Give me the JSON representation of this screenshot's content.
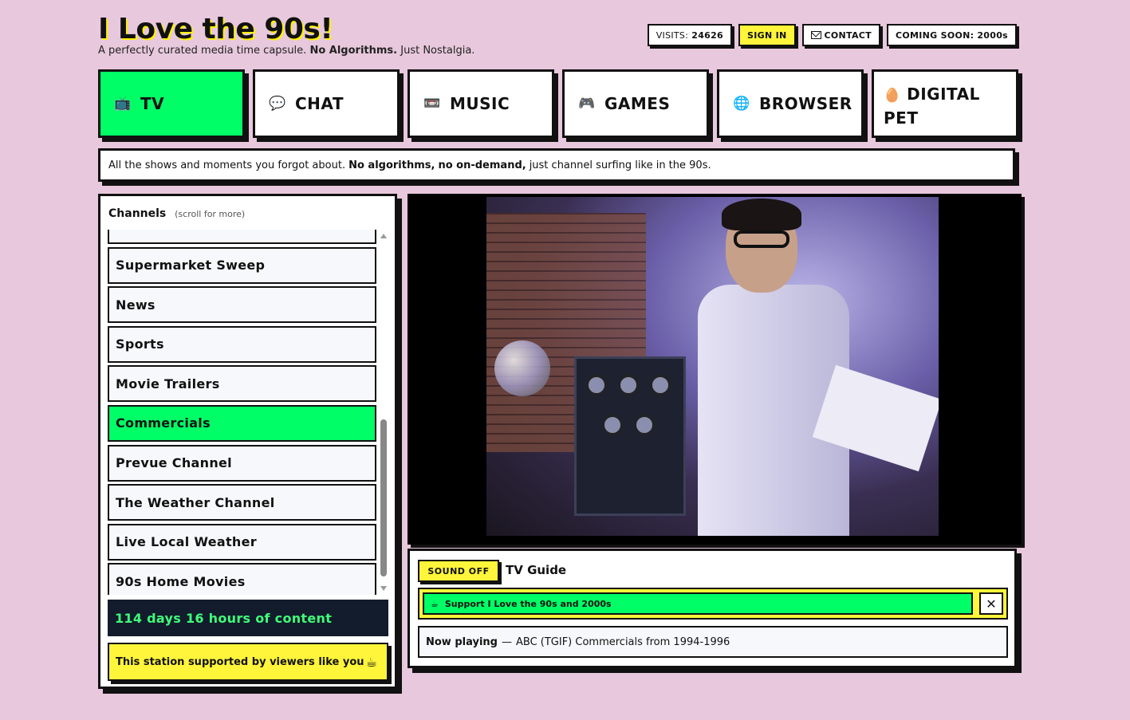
{
  "header": {
    "title": "I Love the 90s!",
    "tagline_pre": "A perfectly curated media time capsule.",
    "tagline_bold": "No Algorithms.",
    "tagline_post": "Just Nostalgia."
  },
  "top_actions": {
    "visits_label": "VISITS:",
    "visits_count": "24626",
    "sign_in": "SIGN IN",
    "contact": "CONTACT",
    "coming_soon_label": "COMING SOON:",
    "coming_soon_value": "2000s"
  },
  "tabs": [
    {
      "label": "TV",
      "icon": "📺"
    },
    {
      "label": "CHAT",
      "icon": "💬"
    },
    {
      "label": "MUSIC",
      "icon": "📼"
    },
    {
      "label": "GAMES",
      "icon": "🎮"
    },
    {
      "label": "BROWSER",
      "icon": "🌐"
    },
    {
      "label": "DIGITAL PET",
      "icon": "🥚"
    }
  ],
  "infobar": {
    "pre": "All the shows and moments you forgot about.",
    "bold1": "No algorithms,",
    "bold2": "no on-demand,",
    "post": "just channel surfing like in the 90s."
  },
  "channels": {
    "heading": "Channels",
    "hint": "(scroll for more)",
    "items": [
      "Supermarket Sweep",
      "News",
      "Sports",
      "Movie Trailers",
      "Commercials",
      "Prevue Channel",
      "The Weather Channel",
      "Live Local Weather",
      "90s Home Movies"
    ],
    "active": "Commercials",
    "total_content": "114 days 16 hours of content",
    "support_text": "This station supported by viewers like you"
  },
  "guide": {
    "sound_button": "SOUND OFF",
    "title": "TV Guide",
    "banner_text": "Support I Love the 90s and 2000s",
    "close_symbol": "✕",
    "now_playing_label": "Now playing",
    "now_playing_sep": "—",
    "now_playing_value": "ABC (TGIF) Commercials from 1994-1996"
  },
  "colors": {
    "background": "#e8c8dc",
    "accent_green": "#00ff66",
    "accent_yellow": "#fff53a",
    "dark_panel": "#121c2c"
  }
}
